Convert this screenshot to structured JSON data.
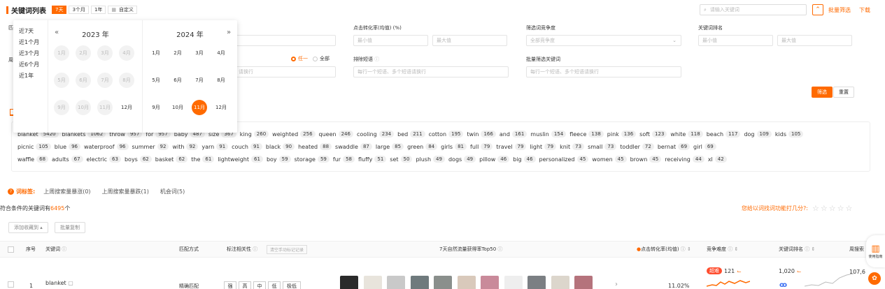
{
  "header": {
    "title": "关键词列表",
    "ranges": [
      "7天",
      "3个月",
      "1年"
    ],
    "custom_label": "自定义",
    "search_placeholder": "请输入关键词",
    "batch_filter": "批量筛选",
    "download": "下载"
  },
  "filters": {
    "match_label": "匹",
    "period_label": "周",
    "ctr_label": "点击转化率(均值) (%)",
    "ctr_min": "最小值",
    "ctr_max": "最大值",
    "competition_label": "筛选词竞争度",
    "competition_placeholder": "全部竞争度",
    "rank_label": "关键词排名",
    "rank_min": "最小值",
    "rank_max": "最大值",
    "radio_any": "任一",
    "radio_all": "全部",
    "include_placeholder": "请换行",
    "exclude_label": "排除短语",
    "exclude_placeholder": "每行一个短语、多个短语请换行",
    "batch_label": "批量筛选关键词",
    "batch_placeholder": "每行一个短语、多个短语请换行",
    "filter_button": "筛选",
    "reset_button": "重置"
  },
  "datepicker": {
    "quick": [
      "近7天",
      "近1个月",
      "近3个月",
      "近6个月",
      "近1年"
    ],
    "left_year": "2023 年",
    "right_year": "2024 年",
    "prev": "«",
    "next": "»",
    "months": [
      "1月",
      "2月",
      "3月",
      "4月",
      "5月",
      "6月",
      "7月",
      "8月",
      "9月",
      "10月",
      "11月",
      "12月"
    ],
    "selected_month": "11月"
  },
  "tag_rows": [
    [
      [
        "blanket",
        "5420"
      ],
      [
        "blankets",
        "1062"
      ],
      [
        "throw",
        "957"
      ],
      [
        "for",
        "957"
      ],
      [
        "baby",
        "487"
      ],
      [
        "size",
        "367"
      ],
      [
        "king",
        "260"
      ],
      [
        "weighted",
        "256"
      ],
      [
        "queen",
        "246"
      ],
      [
        "cooling",
        "234"
      ],
      [
        "bed",
        "211"
      ],
      [
        "cotton",
        "195"
      ],
      [
        "twin",
        "166"
      ],
      [
        "and",
        "161"
      ],
      [
        "muslin",
        "154"
      ],
      [
        "fleece",
        "138"
      ],
      [
        "pink",
        "136"
      ],
      [
        "soft",
        "123"
      ],
      [
        "white",
        "118"
      ],
      [
        "beach",
        "117"
      ],
      [
        "dog",
        "109"
      ],
      [
        "kids",
        "105"
      ]
    ],
    [
      [
        "picnic",
        "105"
      ],
      [
        "blue",
        "96"
      ],
      [
        "waterproof",
        "96"
      ],
      [
        "summer",
        "92"
      ],
      [
        "with",
        "92"
      ],
      [
        "yarn",
        "91"
      ],
      [
        "couch",
        "91"
      ],
      [
        "black",
        "90"
      ],
      [
        "heated",
        "88"
      ],
      [
        "swaddle",
        "87"
      ],
      [
        "large",
        "85"
      ],
      [
        "green",
        "84"
      ],
      [
        "girls",
        "81"
      ],
      [
        "full",
        "79"
      ],
      [
        "travel",
        "79"
      ],
      [
        "light",
        "79"
      ],
      [
        "knit",
        "73"
      ],
      [
        "small",
        "73"
      ],
      [
        "toddler",
        "72"
      ],
      [
        "bernat",
        "69"
      ],
      [
        "girl",
        "69"
      ]
    ],
    [
      [
        "waffle",
        "68"
      ],
      [
        "adults",
        "67"
      ],
      [
        "electric",
        "63"
      ],
      [
        "boys",
        "62"
      ],
      [
        "basket",
        "62"
      ],
      [
        "the",
        "61"
      ],
      [
        "lightweight",
        "61"
      ],
      [
        "boy",
        "59"
      ],
      [
        "storage",
        "59"
      ],
      [
        "fur",
        "58"
      ],
      [
        "fluffy",
        "51"
      ],
      [
        "set",
        "50"
      ],
      [
        "plush",
        "49"
      ],
      [
        "dogs",
        "49"
      ],
      [
        "pillow",
        "46"
      ],
      [
        "big",
        "46"
      ],
      [
        "personalized",
        "45"
      ],
      [
        "women",
        "45"
      ],
      [
        "brown",
        "45"
      ],
      [
        "receiving",
        "44"
      ],
      [
        "xl",
        "42"
      ]
    ]
  ],
  "word_tags": {
    "label": "词标签:",
    "items": [
      "上周搜索量暴涨(0)",
      "上周搜索量暴跌(1)",
      "机会词(5)"
    ]
  },
  "result": {
    "prefix": "符合条件的关键词有",
    "count": "6495",
    "suffix": "个",
    "rating_prompt": "您给以词找词功能打几分?:"
  },
  "actions": {
    "add_favorite": "添加收藏到 ▴",
    "batch_copy": "批量复制"
  },
  "table": {
    "headers": {
      "no": "序号",
      "keyword": "关键词",
      "match": "匹配方式",
      "relevance": "标注相关性",
      "clear_marks": "清空手动标记记录",
      "top50": "7天自然流量获得率Top50",
      "ctr": "点击转化率(均值)",
      "competition": "竞争难度",
      "rank": "关键词排名",
      "search_volume": "周搜索"
    },
    "row": {
      "no": "1",
      "keyword": "blanket",
      "match": "精确匹配",
      "relevance": [
        "强",
        "高",
        "中",
        "低",
        "极低"
      ],
      "ctr": "11.02%",
      "competition_badge": "超难",
      "competition": "121",
      "rank": "1,020",
      "volume": "107,6"
    }
  },
  "side": {
    "guide": "使用指南"
  },
  "colors": {
    "accent": "#ff6a00"
  }
}
